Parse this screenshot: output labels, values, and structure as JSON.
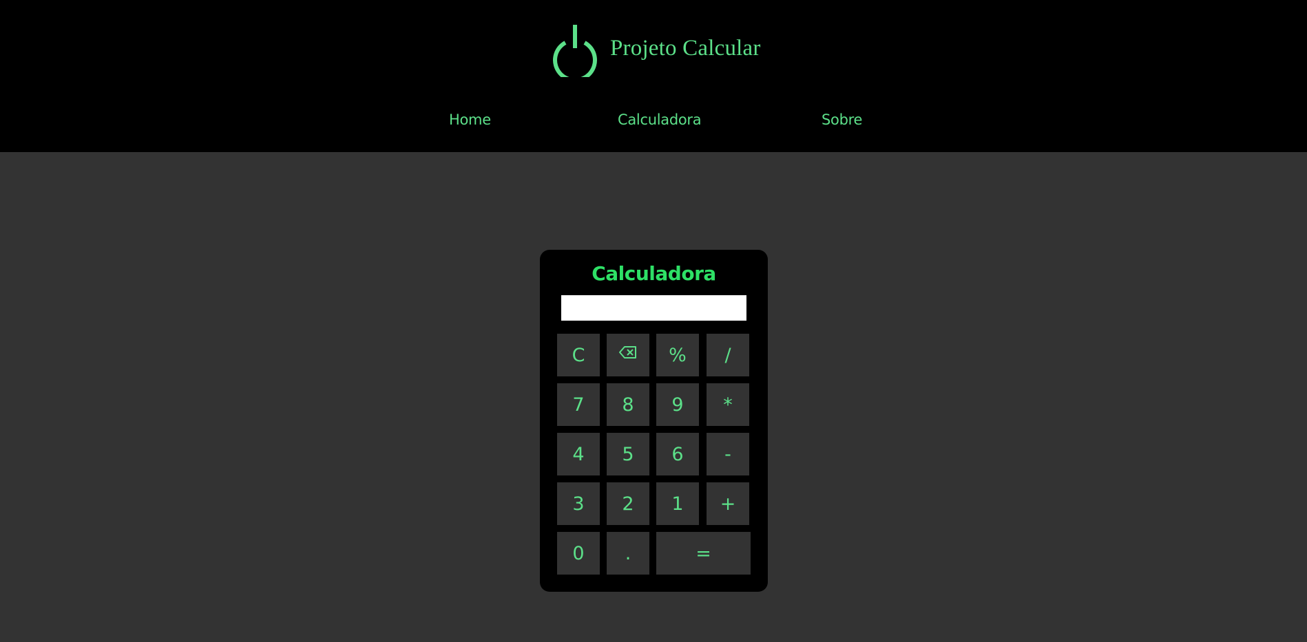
{
  "header": {
    "brand_title": "Projeto Calcular",
    "logo_icon": "power-icon",
    "nav": {
      "home": "Home",
      "calculadora": "Calculadora",
      "sobre": "Sobre"
    }
  },
  "calculator": {
    "title": "Calculadora",
    "display_value": "",
    "keys": {
      "clear": "C",
      "backspace_icon": "backspace-icon",
      "percent": "%",
      "divide": "/",
      "seven": "7",
      "eight": "8",
      "nine": "9",
      "multiply": "*",
      "four": "4",
      "five": "5",
      "six": "6",
      "subtract": "-",
      "three": "3",
      "two": "2",
      "one": "1",
      "add": "+",
      "zero": "0",
      "decimal": ".",
      "equals": "="
    }
  },
  "colors": {
    "accent": "#5ce089",
    "title_green": "#2ee066",
    "page_background": "#333333",
    "header_background": "#000000",
    "calculator_background": "#000000",
    "key_background": "#333333",
    "display_background": "#ffffff"
  }
}
